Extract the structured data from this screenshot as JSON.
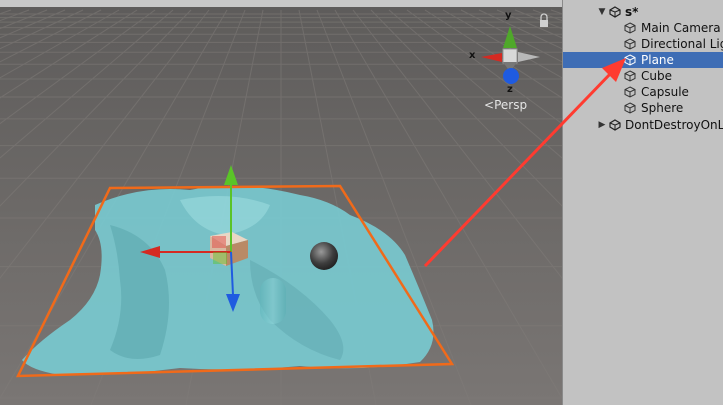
{
  "scene": {
    "persp_label": "Persp",
    "gizmo_axes": {
      "x": "x",
      "y": "y",
      "z": "z"
    }
  },
  "hierarchy": {
    "scene_name": "s*",
    "items": [
      {
        "label": "Main Camera",
        "selected": false
      },
      {
        "label": "Directional Light",
        "selected": false
      },
      {
        "label": "Plane",
        "selected": true
      },
      {
        "label": "Cube",
        "selected": false
      },
      {
        "label": "Capsule",
        "selected": false
      },
      {
        "label": "Sphere",
        "selected": false
      }
    ],
    "dont_destroy_label": "DontDestroyOnLoad"
  },
  "colors": {
    "selection": "#3e6db5",
    "annotation": "#ff3b30",
    "selection_outline": "#f06a1a",
    "plane": "#7ccfd4",
    "x_axis": "#d52a22",
    "y_axis": "#5ac427",
    "z_axis": "#1f5be0"
  },
  "icons": [
    "cube-icon",
    "unity-scene-icon",
    "expand-arrow-icon",
    "collapse-arrow-icon",
    "lock-icon"
  ]
}
